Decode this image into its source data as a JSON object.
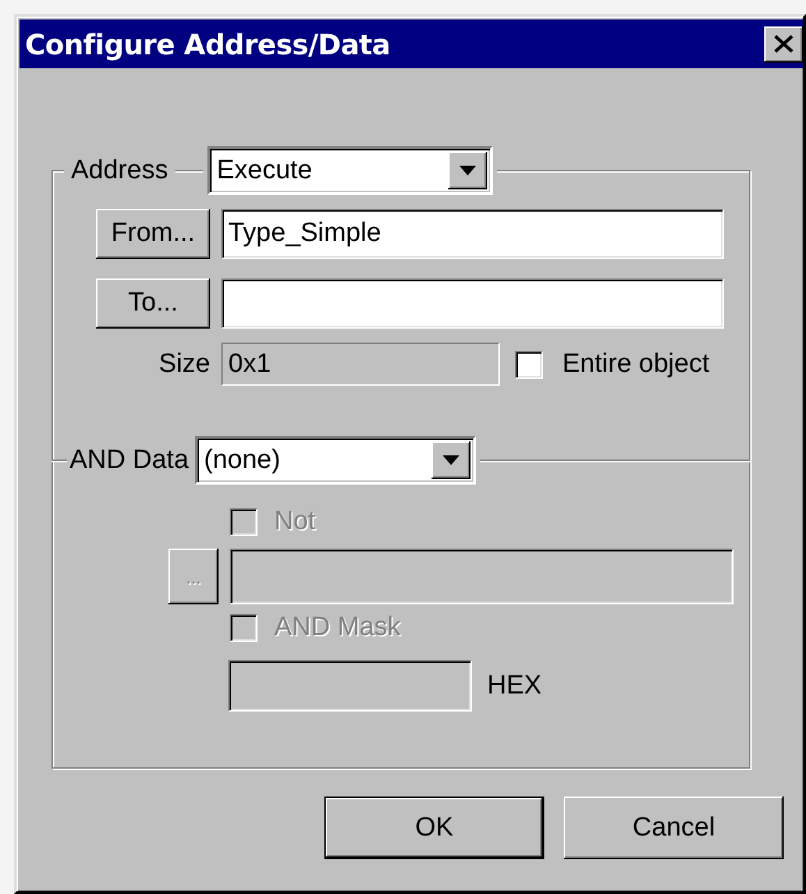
{
  "window": {
    "title": "Configure Address/Data"
  },
  "address": {
    "label": "Address",
    "combo_value": "Execute",
    "from_button": "From...",
    "from_value": "Type_Simple",
    "to_button": "To...",
    "size_label": "Size",
    "size_value": "0x1",
    "entire_object": {
      "label": "Entire object",
      "checked": false
    }
  },
  "and_data": {
    "label": "AND Data",
    "combo_value": "(none)",
    "not": {
      "label": "Not",
      "checked": false,
      "disabled": true
    },
    "browse_button": {
      "label": "...",
      "disabled": true
    },
    "data_field": {
      "disabled": true
    },
    "mask": {
      "label": "AND Mask",
      "checked": false,
      "disabled": true
    },
    "mask_field": {
      "disabled": true
    },
    "hex_label": "HEX"
  },
  "buttons": [
    {
      "label": "OK",
      "default": true
    },
    {
      "label": "Cancel",
      "default": false
    }
  ]
}
